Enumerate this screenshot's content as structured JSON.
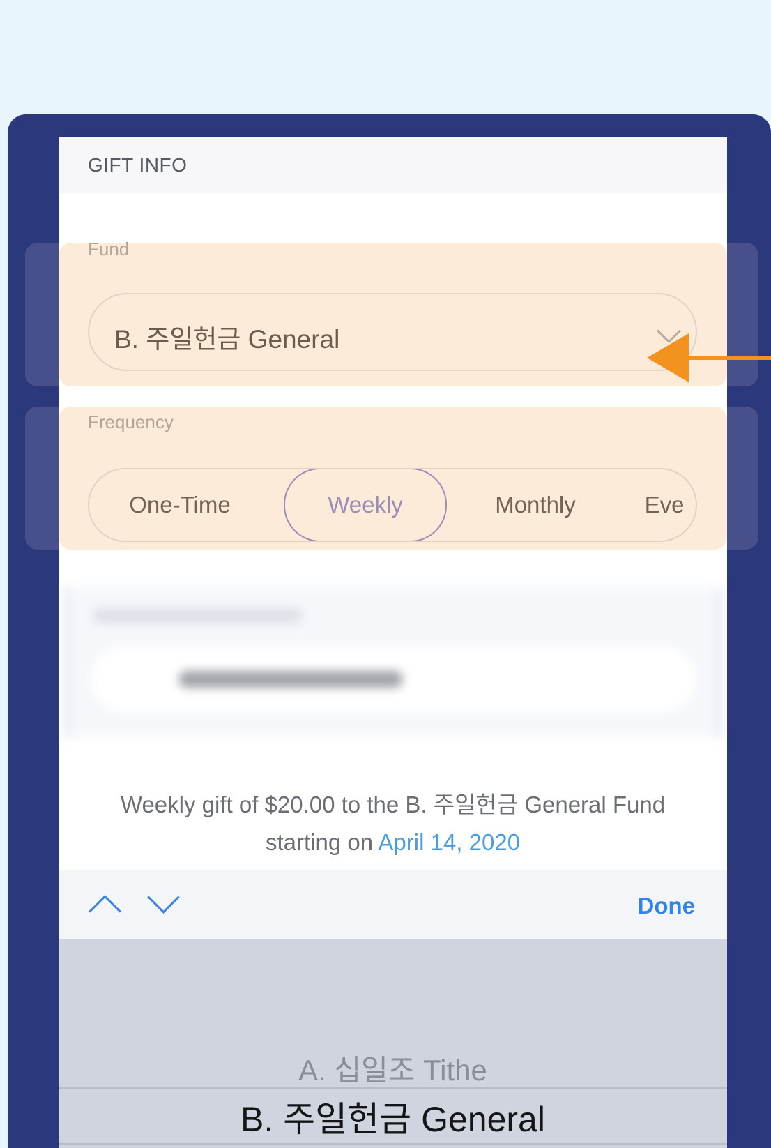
{
  "header": {
    "title": "GIFT INFO"
  },
  "fund": {
    "label": "Fund",
    "selected": "B. 주일헌금 General"
  },
  "frequency": {
    "label": "Frequency",
    "options": [
      "One-Time",
      "Weekly",
      "Monthly",
      "Eve"
    ],
    "selected": "Weekly"
  },
  "summary": {
    "text": "Weekly gift of $20.00 to the B. 주일헌금 General Fund",
    "starting_prefix": "starting on",
    "date": "April 14, 2020"
  },
  "toolbar": {
    "done_label": "Done"
  },
  "picker": {
    "items": [
      "A. 십일조 Tithe",
      "B. 주일헌금 General"
    ],
    "selected_index": 1
  },
  "colors": {
    "brand_navy": "#2b397c",
    "accent_orange": "#f2921f",
    "selected_purple": "#6770cd",
    "link_blue": "#2f86e8"
  }
}
